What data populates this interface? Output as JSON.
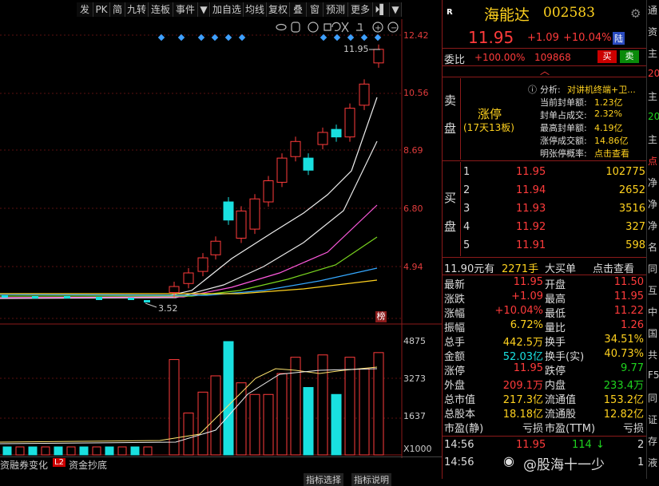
{
  "toolbar": {
    "items": [
      "发",
      "PK",
      "简",
      "九转",
      "连板",
      "事件",
      "▼",
      "加自选",
      "均线",
      "复权",
      "叠",
      "窗",
      "预测",
      "更多",
      "⏵▌",
      "▼"
    ]
  },
  "chart": {
    "price_ticks": [
      "12.42",
      "10.56",
      "8.69",
      "6.80",
      "4.94"
    ],
    "volume_ticks": [
      "4875",
      "3273",
      "1637",
      "X1000"
    ],
    "last_price_label": "11.95",
    "low_label": "3.52",
    "bang_label": "榜"
  },
  "bottom_tabs": [
    "资融券变化",
    "L2",
    "资金抄底"
  ],
  "bottom_strip": [
    "指标选择",
    "指标说明"
  ],
  "header": {
    "r_badge": "R",
    "name": "海能达",
    "code": "002583",
    "price": "11.95",
    "change": "+1.09",
    "pct": "+10.04%",
    "lu": "陆"
  },
  "weibi": {
    "label": "委比",
    "value": "+100.00%",
    "diff": "109868",
    "buy": "买",
    "sell": "卖"
  },
  "sell_side": {
    "label_top": "卖",
    "label_bottom": "盘",
    "zhangting": "涨停",
    "days": "(17天13板)",
    "analysis_label": "分析:",
    "analysis_text": "对讲机终端+卫...",
    "rows": [
      {
        "k": "当前封单额:",
        "v": "1.23亿"
      },
      {
        "k": "封单占成交:",
        "v": "2.32%"
      },
      {
        "k": "最高封单额:",
        "v": "4.19亿"
      },
      {
        "k": "涨停成交额:",
        "v": "14.86亿"
      },
      {
        "k": "明张停概率:",
        "v": "点击查看"
      }
    ]
  },
  "buy_side": {
    "label_top": "买",
    "label_bottom": "盘",
    "rows": [
      {
        "n": "1",
        "p": "11.95",
        "q": "102775"
      },
      {
        "n": "2",
        "p": "11.94",
        "q": "2652"
      },
      {
        "n": "3",
        "p": "11.93",
        "q": "3516"
      },
      {
        "n": "4",
        "p": "11.92",
        "q": "327"
      },
      {
        "n": "5",
        "p": "11.91",
        "q": "598"
      }
    ]
  },
  "big_order": {
    "price": "11.90元有",
    "qty": "2271手",
    "label": "大买单",
    "link": "点击查看"
  },
  "stats": [
    {
      "k1": "最新",
      "v1": "11.95",
      "c1": "red",
      "k2": "开盘",
      "v2": "11.50",
      "c2": "red"
    },
    {
      "k1": "涨跌",
      "v1": "+1.09",
      "c1": "red",
      "k2": "最高",
      "v2": "11.95",
      "c2": "red"
    },
    {
      "k1": "涨幅",
      "v1": "+10.04%",
      "c1": "red",
      "k2": "最低",
      "v2": "11.22",
      "c2": "red"
    },
    {
      "k1": "振幅",
      "v1": "6.72%",
      "c1": "yellow",
      "k2": "量比",
      "v2": "1.26",
      "c2": "red"
    },
    {
      "k1": "总手",
      "v1": "442.5万",
      "c1": "yellow",
      "k2": "换手",
      "v2": "34.51%",
      "c2": "yellow"
    },
    {
      "k1": "金额",
      "v1": "52.03亿",
      "c1": "cyan",
      "k2": "换手(实)",
      "v2": "40.73%",
      "c2": "yellow"
    },
    {
      "k1": "涨停",
      "v1": "11.95",
      "c1": "red",
      "k2": "跌停",
      "v2": "9.77",
      "c2": "green"
    },
    {
      "k1": "外盘",
      "v1": "209.1万",
      "c1": "red",
      "k2": "内盘",
      "v2": "233.4万",
      "c2": "green"
    },
    {
      "k1": "总市值",
      "v1": "217.3亿",
      "c1": "yellow",
      "k2": "流通值",
      "v2": "153.2亿",
      "c2": "yellow"
    },
    {
      "k1": "总股本",
      "v1": "18.18亿",
      "c1": "yellow",
      "k2": "流通股",
      "v2": "12.82亿",
      "c2": "yellow"
    },
    {
      "k1": "市盈(静)",
      "v1": "亏损",
      "c1": "white",
      "k2": "市盈(TTM)",
      "v2": "亏损",
      "c2": "white"
    }
  ],
  "ticks": [
    {
      "t": "14:56",
      "p": "11.95",
      "q": "114",
      "arrow": "↓",
      "n": "2"
    },
    {
      "t": "14:56",
      "p": "",
      "q": "",
      "arrow": "",
      "n": "1"
    }
  ],
  "watermark": "@股海十一少",
  "far_right": [
    "通",
    "资",
    "主",
    "20",
    "主",
    "20",
    "主",
    "点",
    "净",
    "净",
    "净",
    "名",
    "同",
    "互",
    "中",
    "国",
    "共",
    "F5",
    "同",
    "证",
    "存",
    "液"
  ],
  "colors": {
    "up": "#ff3b3b",
    "down": "#19e0e0",
    "border": "#8b1a1a"
  },
  "chart_data": {
    "type": "candlestick",
    "price_axis": [
      3.52,
      12.42
    ],
    "candles": [
      {
        "o": 3.9,
        "c": 4.1
      },
      {
        "o": 4.2,
        "c": 4.55
      },
      {
        "o": 4.6,
        "c": 5.05
      },
      {
        "o": 5.15,
        "c": 5.6
      },
      {
        "o": 5.7,
        "c": 6.6
      },
      {
        "o": 6.0,
        "c": 7.0
      },
      {
        "o": 6.9,
        "c": 6.3
      },
      {
        "o": 6.9,
        "c": 7.6
      },
      {
        "o": 7.55,
        "c": 8.35
      },
      {
        "o": 8.4,
        "c": 8.9
      },
      {
        "o": 8.35,
        "c": 7.95
      },
      {
        "o": 8.8,
        "c": 9.2
      },
      {
        "o": 9.3,
        "c": 9.05
      },
      {
        "o": 9.05,
        "c": 10.0
      },
      {
        "o": 10.1,
        "c": 10.8
      },
      {
        "o": 11.5,
        "c": 11.95
      }
    ],
    "volume_axis": [
      0,
      4875
    ],
    "volumes": [
      4100,
      1800,
      2700,
      3400,
      3100,
      2600,
      4875,
      2600,
      3500,
      4200,
      2900,
      4300,
      2600,
      4200,
      3700,
      4400
    ]
  }
}
